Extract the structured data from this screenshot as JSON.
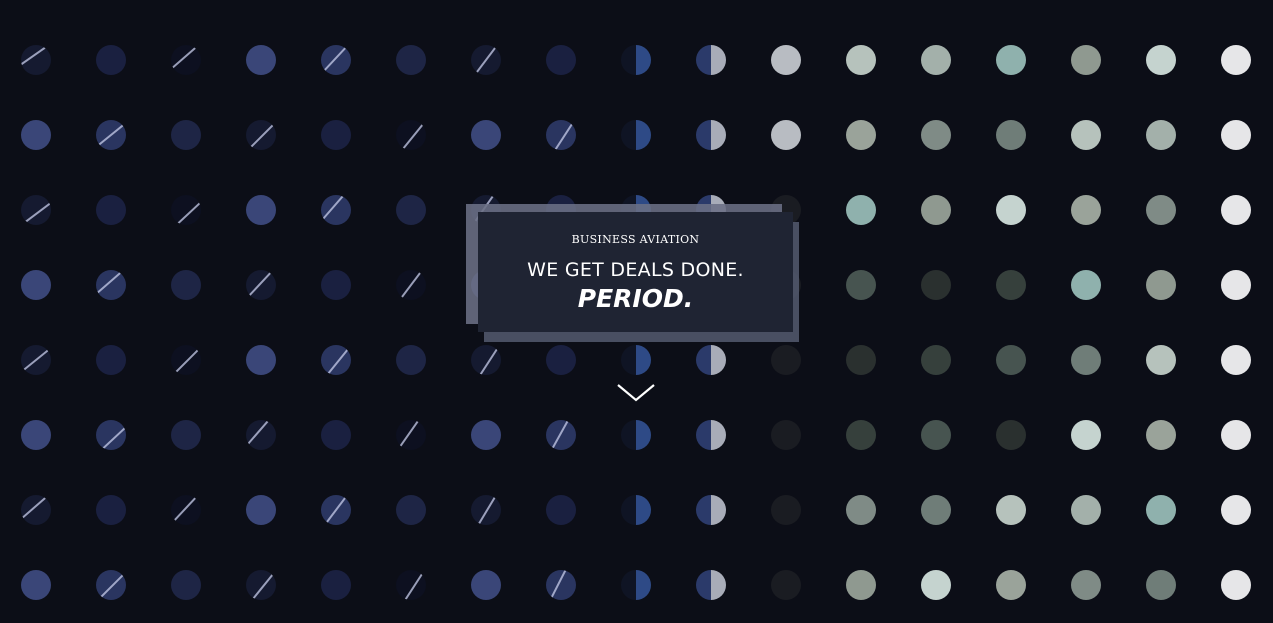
{
  "hero": {
    "eyebrow": "BUSINESS AVIATION",
    "line1": "WE GET DEALS DONE.",
    "line2": "PERIOD."
  },
  "scroll_button": {
    "icon": "chevron-down-icon"
  },
  "colors": {
    "background": "#0c0e17",
    "card": "#1f2433",
    "card_back": "#6b6f85",
    "text": "#ffffff"
  }
}
